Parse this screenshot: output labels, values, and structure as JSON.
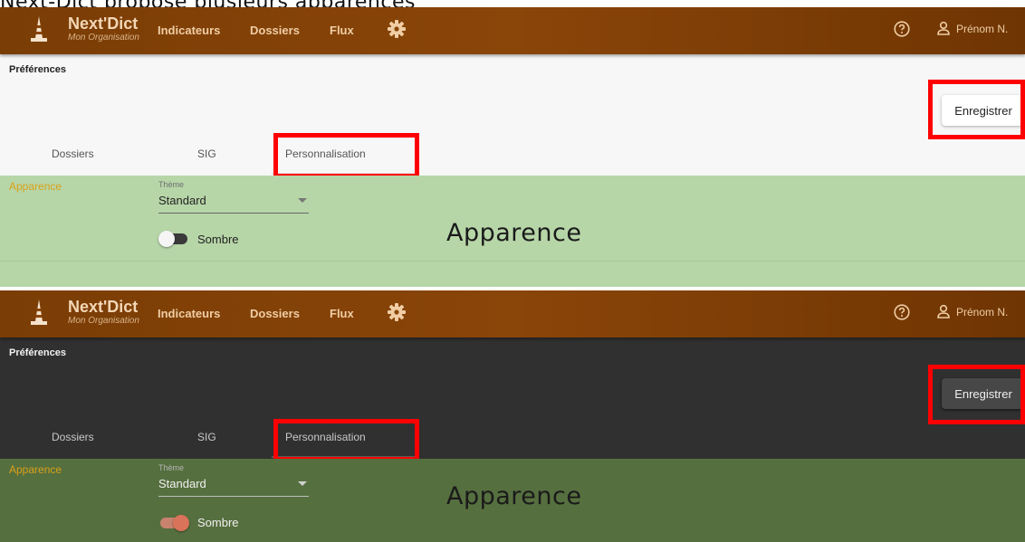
{
  "caption": "Next-Dict propose plusieurs apparences",
  "overlay_label": "Apparence",
  "nav": {
    "brand_name": "Next'Dict",
    "brand_org": "Mon Organisation",
    "links": [
      "Indicateurs",
      "Dossiers",
      "Flux"
    ],
    "user_name": "Prénom N.",
    "icons": [
      "cone-logo-icon",
      "gear-icon",
      "help-circle-icon",
      "user-icon"
    ]
  },
  "page_title": "Préférences",
  "save_label": "Enregistrer",
  "tabs": [
    "Dossiers",
    "SIG",
    "Personnalisation"
  ],
  "section": {
    "title": "Apparence",
    "theme_label": "Thème",
    "theme_value": "Standard",
    "toggle_label": "Sombre"
  },
  "variants": {
    "light": {
      "dark_mode_on": false
    },
    "dark": {
      "dark_mode_on": true
    }
  },
  "colors": {
    "navbar": "#7a3d05",
    "highlight_box": "#ff0000",
    "section_light": "#b7d6a8",
    "section_dark": "#566f3f",
    "section_title": "#d8a11a"
  }
}
